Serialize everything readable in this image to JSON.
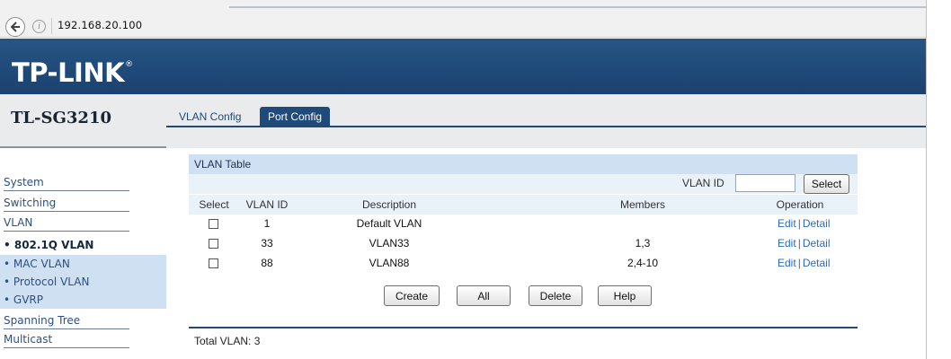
{
  "browser": {
    "url": "192.168.20.100",
    "back_icon": "back-arrow-icon",
    "info_icon": "info-icon"
  },
  "brand": {
    "logo": "TP-LINK",
    "logo_mark": "®",
    "model": "TL-SG3210",
    "colors": {
      "banner": "#1f4a79",
      "sidebar_sub": "#cfe0f2",
      "link": "#2d6bb8"
    }
  },
  "sidebar": {
    "items": [
      {
        "label": "System",
        "kind": "main"
      },
      {
        "label": "Switching",
        "kind": "main"
      },
      {
        "label": "VLAN",
        "kind": "main"
      },
      {
        "label": "• 802.1Q VLAN",
        "kind": "active"
      },
      {
        "label": "• MAC VLAN",
        "kind": "sub"
      },
      {
        "label": "• Protocol VLAN",
        "kind": "sub"
      },
      {
        "label": "• GVRP",
        "kind": "sub"
      },
      {
        "label": "Spanning Tree",
        "kind": "main"
      },
      {
        "label": "Multicast",
        "kind": "main"
      }
    ]
  },
  "tabs": [
    {
      "label": "VLAN Config",
      "active": false
    },
    {
      "label": "Port Config",
      "active": true
    }
  ],
  "vlan_table": {
    "title": "VLAN Table",
    "search": {
      "label": "VLAN ID",
      "value": "",
      "button": "Select"
    },
    "columns": [
      "Select",
      "VLAN ID",
      "Description",
      "Members",
      "Operation"
    ],
    "rows": [
      {
        "checkbox": true,
        "vlan_id": "1",
        "description": "Default VLAN",
        "members": "",
        "edit": "Edit",
        "sep": "|",
        "detail": "Detail"
      },
      {
        "checkbox": true,
        "vlan_id": "33",
        "description": "VLAN33",
        "members": "1,3",
        "edit": "Edit",
        "sep": "|",
        "detail": "Detail"
      },
      {
        "checkbox": true,
        "vlan_id": "88",
        "description": "VLAN88",
        "members": "2,4-10",
        "edit": "Edit",
        "sep": "|",
        "detail": "Detail"
      }
    ],
    "buttons": {
      "create": "Create",
      "all": "All",
      "delete": "Delete",
      "help": "Help"
    },
    "total": "Total VLAN: 3"
  }
}
